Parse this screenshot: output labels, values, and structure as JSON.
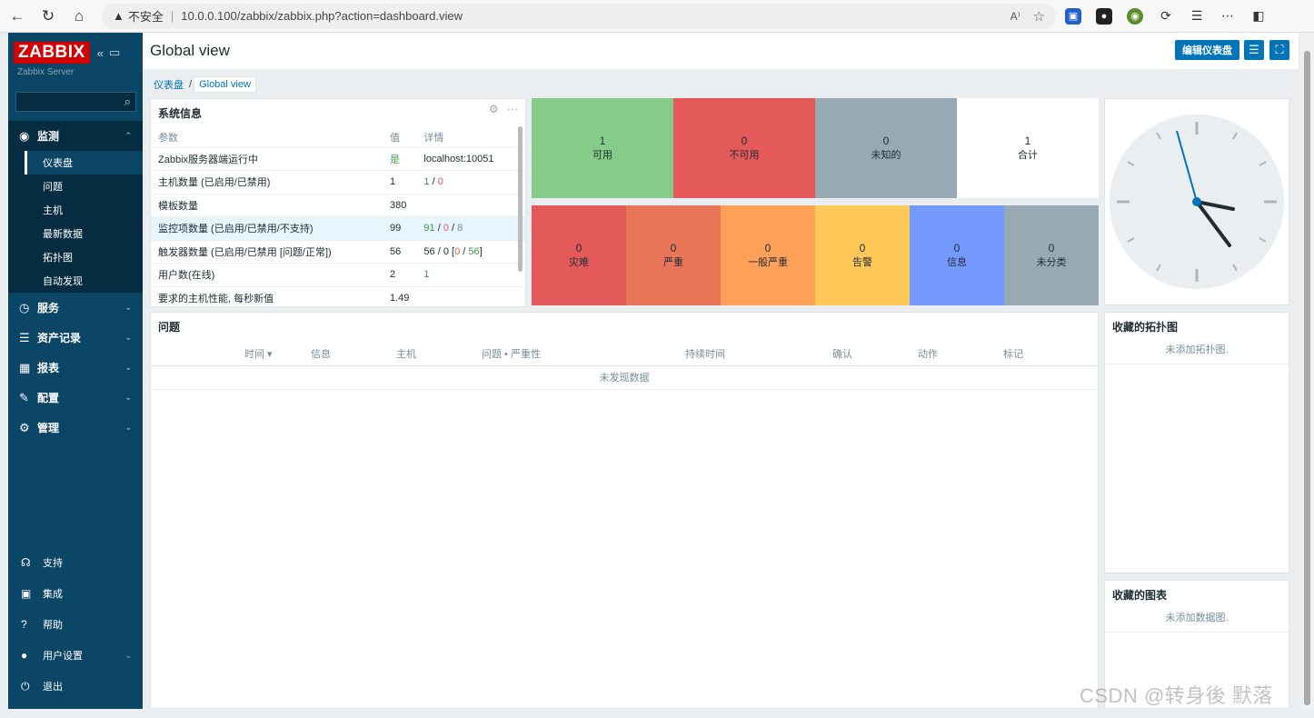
{
  "browser": {
    "security_label": "不安全",
    "url": "10.0.0.100/zabbix/zabbix.php?action=dashboard.view",
    "read_aloud": "A⁾"
  },
  "sidebar": {
    "logo": "ZABBIX",
    "server_name": "Zabbix Server",
    "sections": [
      {
        "label": "监测",
        "icon": "eye-icon"
      },
      {
        "label": "服务",
        "icon": "clock-icon"
      },
      {
        "label": "资产记录",
        "icon": "list-icon"
      },
      {
        "label": "报表",
        "icon": "chart-icon"
      },
      {
        "label": "配置",
        "icon": "wrench-icon"
      },
      {
        "label": "管理",
        "icon": "gear-icon"
      }
    ],
    "monitoring_items": [
      "仪表盘",
      "问题",
      "主机",
      "最新数据",
      "拓扑图",
      "自动发现"
    ],
    "bottom": [
      {
        "label": "支持"
      },
      {
        "label": "集成"
      },
      {
        "label": "帮助"
      },
      {
        "label": "用户设置"
      },
      {
        "label": "退出"
      }
    ]
  },
  "header": {
    "title": "Global view",
    "edit_button": "编辑仪表盘"
  },
  "breadcrumb": {
    "root": "仪表盘",
    "sep": "/",
    "current": "Global view"
  },
  "system_info": {
    "title": "系统信息",
    "columns": [
      "参数",
      "值",
      "详情"
    ],
    "rows": [
      {
        "param": "Zabbix服务器端运行中",
        "value": "是",
        "detail": "localhost:10051"
      },
      {
        "param": "主机数量 (已启用/已禁用)",
        "value": "1",
        "d1": "1",
        "d2": "0"
      },
      {
        "param": "模板数量",
        "value": "380"
      },
      {
        "param": "监控项数量 (已启用/已禁用/不支持)",
        "value": "99",
        "d1": "91",
        "d2": "0",
        "d3": "8"
      },
      {
        "param": "触发器数量 (已启用/已禁用 [问题/正常])",
        "value": "56",
        "d_prefix": "56 / 0 [",
        "d1": "0",
        "d_sep": " / ",
        "d2": "56",
        "d_suffix": "]"
      },
      {
        "param": "用户数(在线)",
        "value": "2",
        "d1": "1"
      },
      {
        "param": "要求的主机性能, 每秒新值",
        "value": "1.49"
      }
    ]
  },
  "host_availability": [
    {
      "count": "1",
      "label": "可用",
      "color": "#86cc89"
    },
    {
      "count": "0",
      "label": "不可用",
      "color": "#e45959"
    },
    {
      "count": "0",
      "label": "未知的",
      "color": "#97aab3"
    },
    {
      "count": "1",
      "label": "合计",
      "color": "#ffffff"
    }
  ],
  "severity": [
    {
      "count": "0",
      "label": "灾难",
      "color": "#e45959"
    },
    {
      "count": "0",
      "label": "严重",
      "color": "#e97659"
    },
    {
      "count": "0",
      "label": "一般严重",
      "color": "#ffa059"
    },
    {
      "count": "0",
      "label": "告警",
      "color": "#ffc859"
    },
    {
      "count": "0",
      "label": "信息",
      "color": "#7499ff"
    },
    {
      "count": "0",
      "label": "未分类",
      "color": "#97aab3"
    }
  ],
  "problems": {
    "title": "问题",
    "columns": [
      "时间 ▾",
      "信息",
      "主机",
      "问题 • 严重性",
      "持续时间",
      "确认",
      "动作",
      "标记"
    ],
    "empty": "未发现数据"
  },
  "fav_maps": {
    "title": "收藏的拓扑图",
    "empty": "未添加拓扑图."
  },
  "fav_graphs": {
    "title": "收藏的图表",
    "empty": "未添加数据图."
  },
  "watermark": "CSDN @转身後 默落"
}
